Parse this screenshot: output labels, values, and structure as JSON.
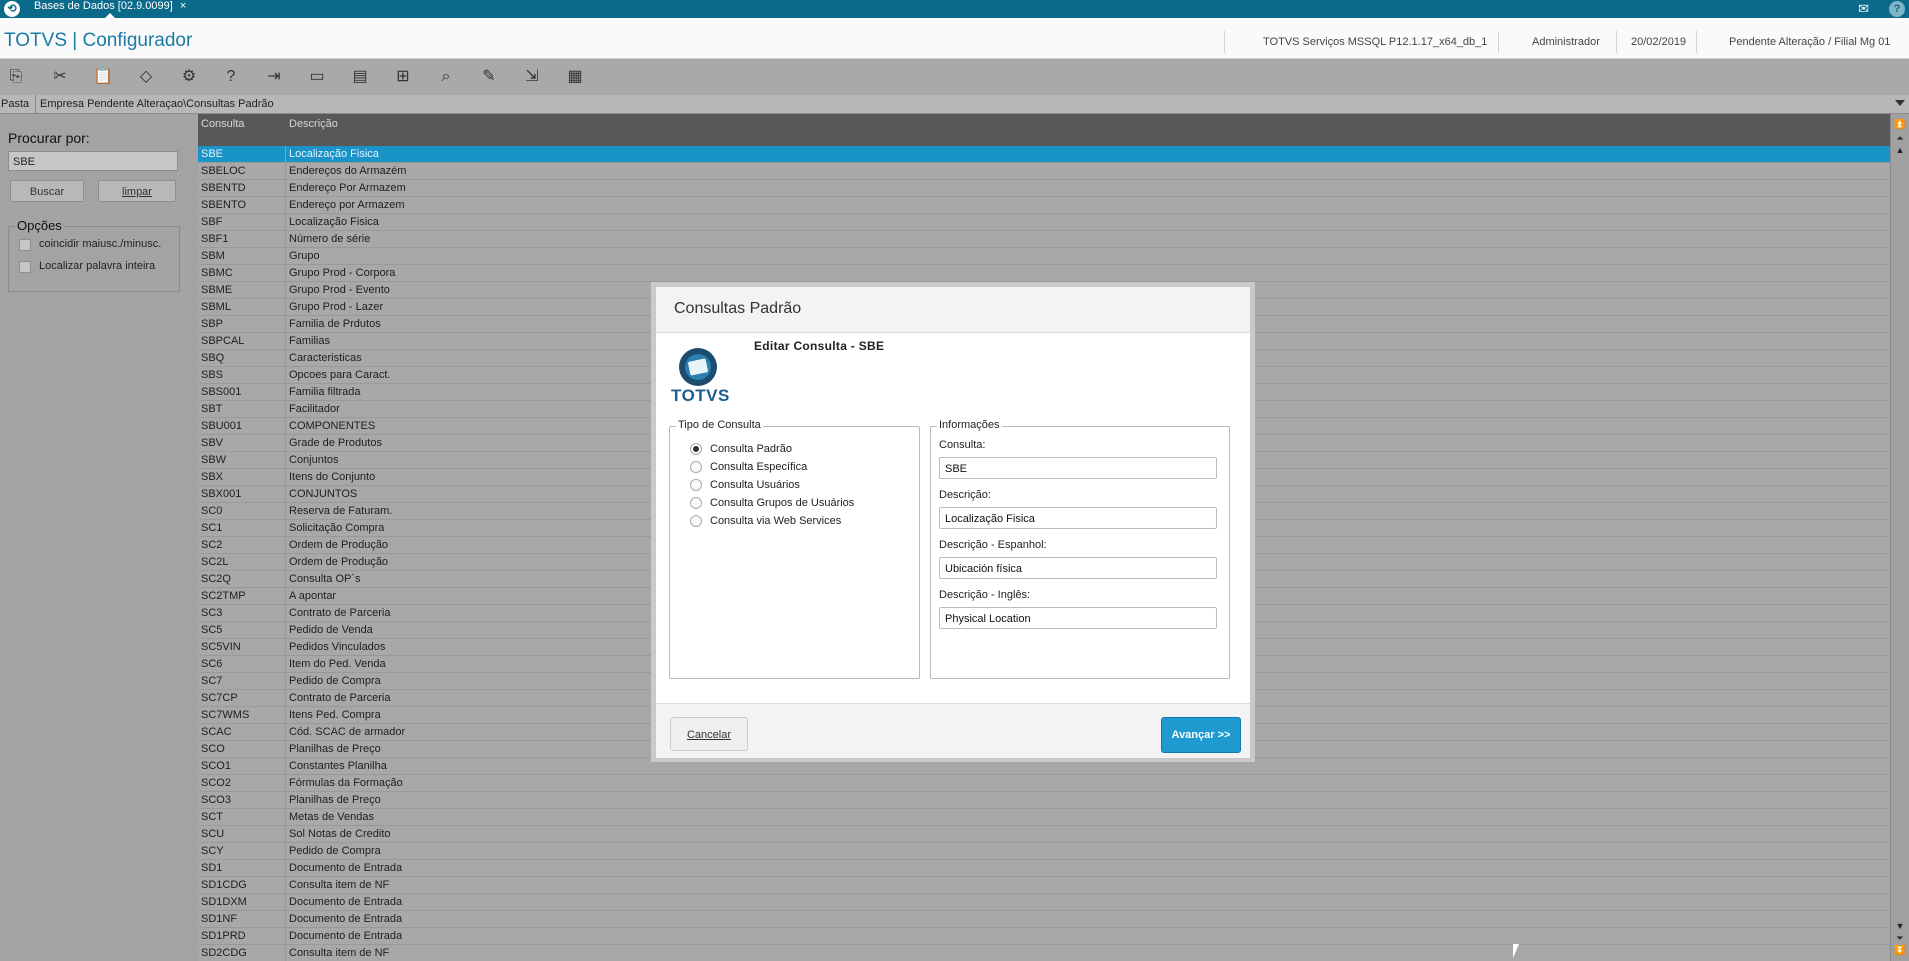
{
  "titlebar": {
    "tab_label": "Bases de Dados [02.9.0099]",
    "close": "×"
  },
  "header": {
    "app_title": "TOTVS | Configurador",
    "environment": "TOTVS Serviços MSSQL P12.1.17_x64_db_1",
    "user": "Administrador",
    "date": "20/02/2019",
    "branch": "Pendente Alteração / Filial Mg 01"
  },
  "toolbar": {
    "icons": [
      "copy-icon",
      "cut-icon",
      "paste-icon",
      "eraser-icon",
      "settings-icon",
      "help-icon",
      "exit-icon",
      "folder-icon",
      "table-icon",
      "add-file-icon",
      "preview-icon",
      "edit-icon",
      "export-icon",
      "calendar-icon"
    ]
  },
  "pathbar": {
    "folder_label": "Pasta",
    "path": "Empresa Pendente Alteraçao\\Consultas Padrão"
  },
  "search": {
    "label": "Procurar por:",
    "value": "SBE",
    "search_button": "Buscar",
    "clear_button": "limpar",
    "options_title": "Opções",
    "option_case": "coincidir maiusc./minusc.",
    "option_whole": "Localizar palavra inteira"
  },
  "grid": {
    "col_code": "Consulta",
    "col_desc": "Descrição",
    "rows": [
      [
        "SBE",
        "Localização Fisica"
      ],
      [
        "SBELOC",
        "Endereços do Armazém"
      ],
      [
        "SBENTD",
        "Endereço Por Armazem"
      ],
      [
        "SBENTO",
        "Endereço por Armazem"
      ],
      [
        "SBF",
        "Localização Fisica"
      ],
      [
        "SBF1",
        "Número de série"
      ],
      [
        "SBM",
        "Grupo"
      ],
      [
        "SBMC",
        "Grupo Prod - Corpora"
      ],
      [
        "SBME",
        "Grupo Prod - Evento"
      ],
      [
        "SBML",
        "Grupo Prod - Lazer"
      ],
      [
        "SBP",
        "Familia de Prdutos"
      ],
      [
        "SBPCAL",
        "Familias"
      ],
      [
        "SBQ",
        "Caracteristicas"
      ],
      [
        "SBS",
        "Opcoes para Caract."
      ],
      [
        "SBS001",
        "Familia filtrada"
      ],
      [
        "SBT",
        "Facilitador"
      ],
      [
        "SBU001",
        "COMPONENTES"
      ],
      [
        "SBV",
        "Grade de Produtos"
      ],
      [
        "SBW",
        "Conjuntos"
      ],
      [
        "SBX",
        "Itens do Conjunto"
      ],
      [
        "SBX001",
        "CONJUNTOS"
      ],
      [
        "SC0",
        "Reserva de Faturam."
      ],
      [
        "SC1",
        "Solicitação Compra"
      ],
      [
        "SC2",
        "Ordem de Produção"
      ],
      [
        "SC2L",
        "Ordem de Produção"
      ],
      [
        "SC2Q",
        "Consulta OP´s"
      ],
      [
        "SC2TMP",
        "A apontar"
      ],
      [
        "SC3",
        "Contrato de Parceria"
      ],
      [
        "SC5",
        "Pedido de Venda"
      ],
      [
        "SC5VIN",
        "Pedidos Vinculados"
      ],
      [
        "SC6",
        "Item do Ped. Venda"
      ],
      [
        "SC7",
        "Pedido de Compra"
      ],
      [
        "SC7CP",
        "Contrato de Parceria"
      ],
      [
        "SC7WMS",
        "Itens Ped. Compra"
      ],
      [
        "SCAC",
        "Cód. SCAC de armador"
      ],
      [
        "SCO",
        "Planilhas de Preço"
      ],
      [
        "SCO1",
        "Constantes Planilha"
      ],
      [
        "SCO2",
        "Fórmulas da Formação"
      ],
      [
        "SCO3",
        "Planilhas de Preço"
      ],
      [
        "SCT",
        "Metas de Vendas"
      ],
      [
        "SCU",
        "Sol Notas de Credito"
      ],
      [
        "SCY",
        "Pedido de Compra"
      ],
      [
        "SD1",
        "Documento de Entrada"
      ],
      [
        "SD1CDG",
        "Consulta item de NF"
      ],
      [
        "SD1DXM",
        "Documento de Entrada"
      ],
      [
        "SD1NF",
        "Documento de Entrada"
      ],
      [
        "SD1PRD",
        "Documento de Entrada"
      ],
      [
        "SD2CDG",
        "Consulta item de NF"
      ]
    ]
  },
  "dialog": {
    "title": "Consultas Padrão",
    "logo_text": "TOTVS",
    "subtitle": "Editar Consulta - SBE",
    "type_group": "Tipo de Consulta",
    "types": [
      "Consulta Padrão",
      "Consulta Específica",
      "Consulta Usuários",
      "Consulta Grupos de Usuários",
      "Consulta via Web Services"
    ],
    "selected_type": "Consulta Padrão",
    "info_group": "Informações",
    "lbl_consulta": "Consulta:",
    "val_consulta": "SBE",
    "lbl_desc": "Descrição:",
    "val_desc": "Localização Fisica",
    "lbl_desc_es": "Descrição - Espanhol:",
    "val_desc_es": "Ubicación física",
    "lbl_desc_en": "Descrição - Inglês:",
    "val_desc_en": "Physical Location",
    "cancel": "Cancelar",
    "next": "Avançar >>"
  },
  "colors": {
    "brand": "#0b6a8a",
    "accent": "#1f9ad0",
    "selected_row": "#1a93c8"
  }
}
